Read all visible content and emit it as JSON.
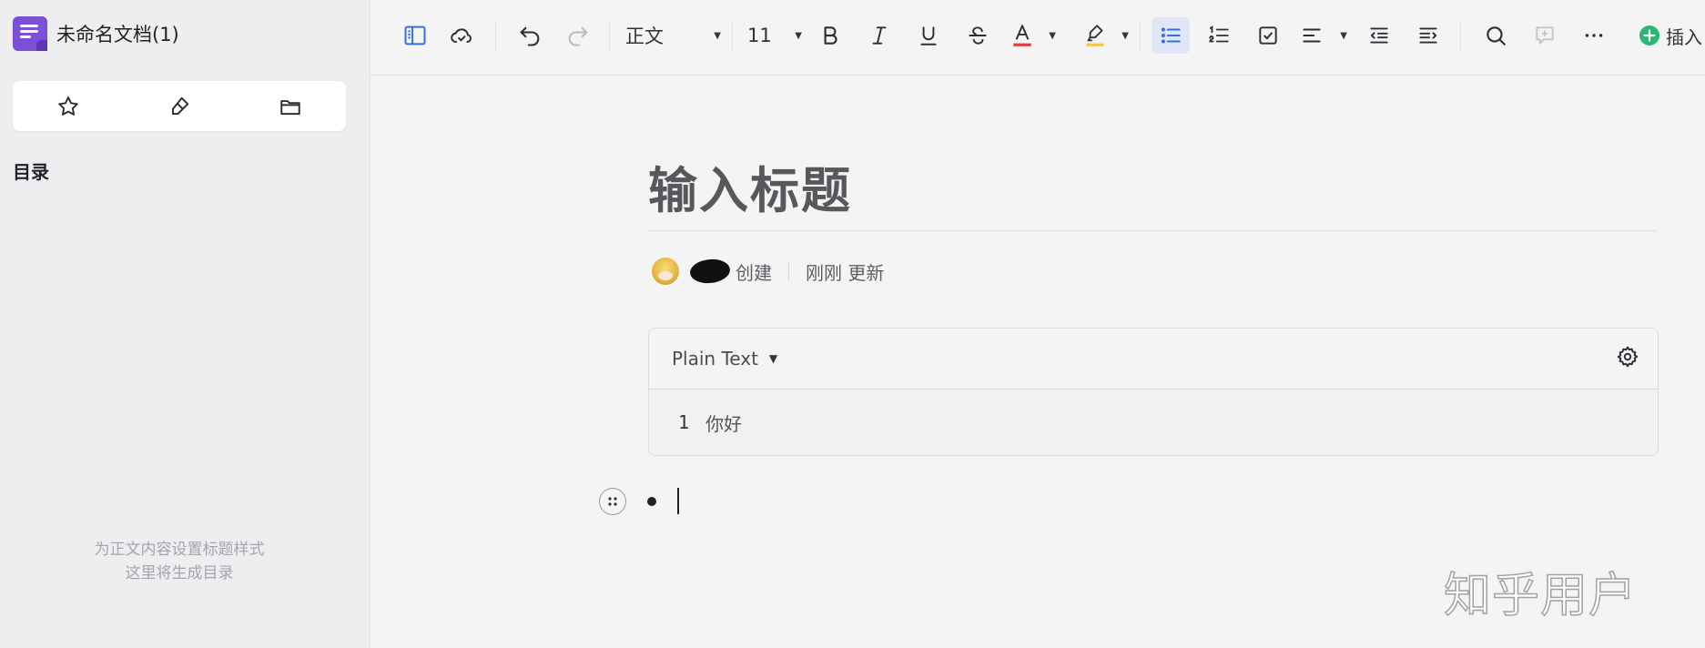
{
  "sidebar": {
    "doc_title": "未命名文档(1)",
    "quick_actions": [
      {
        "icon": "star-icon"
      },
      {
        "icon": "eraser-icon"
      },
      {
        "icon": "folder-icon"
      }
    ],
    "toc_title": "目录",
    "toc_hint_line1": "为正文内容设置标题样式",
    "toc_hint_line2": "这里将生成目录"
  },
  "toolbar": {
    "style_label": "正文",
    "font_size": "11",
    "insert_label": "插入",
    "colors": {
      "text_color_bar": "#e03e3e",
      "highlight_bar": "#f2c84b",
      "active_bg": "#dfe7f7",
      "insert_green": "#2bb673"
    }
  },
  "document": {
    "title_placeholder": "输入标题",
    "meta_created": "创建",
    "meta_updated": "刚刚 更新",
    "code_language": "Plain Text",
    "code_lines": [
      {
        "number": "1",
        "text": "你好"
      }
    ]
  },
  "watermark": "知乎用户"
}
